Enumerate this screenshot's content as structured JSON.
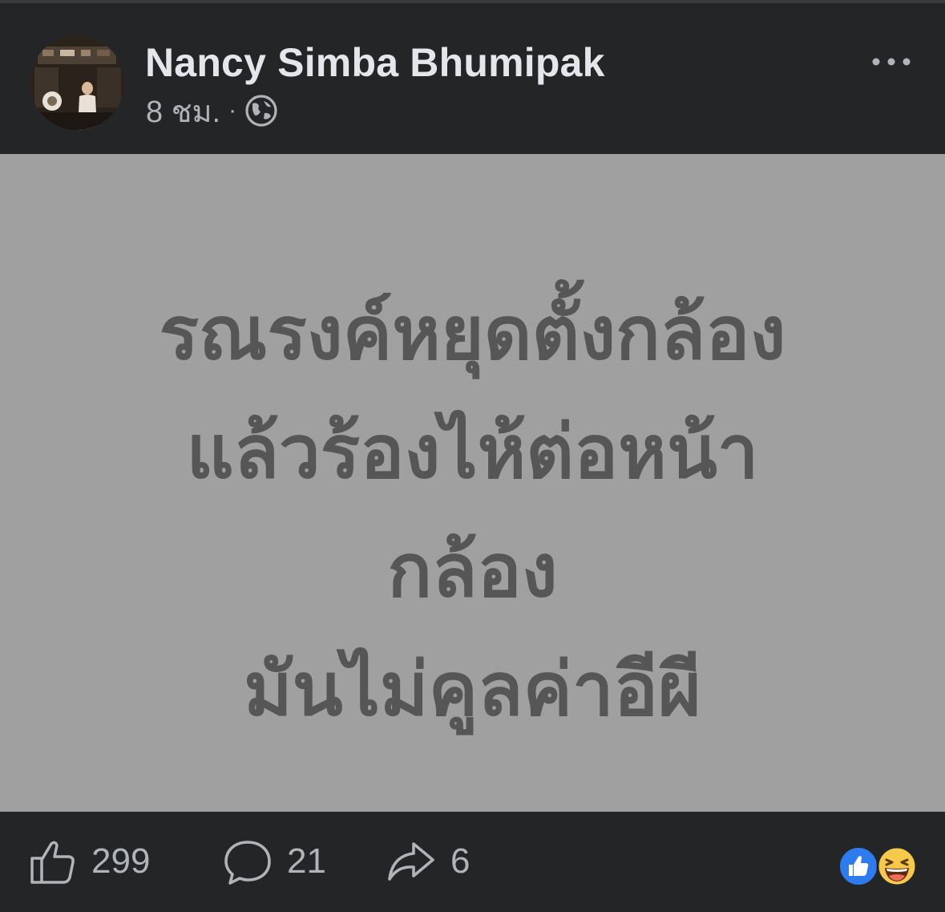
{
  "post": {
    "author": "Nancy Simba Bhumipak",
    "time": "8 ชม.",
    "separator": "·",
    "privacy_icon": "globe-icon",
    "more_icon": "more-options-icon",
    "content_lines": [
      "รณรงค์หยุดตั้งกล้อง",
      "แล้วร้องไห้ต่อหน้า",
      "กล้อง",
      "มันไม่คูลค่าอีผี"
    ],
    "background_color": "#a0a0a0",
    "text_color": "#565656"
  },
  "footer": {
    "likes": "299",
    "comments": "21",
    "shares": "6",
    "like_icon": "thumbs-up-icon",
    "comment_icon": "comment-icon",
    "share_icon": "share-icon",
    "reactions": [
      "like-reaction-icon",
      "haha-reaction-icon"
    ]
  },
  "colors": {
    "surface": "#242526",
    "primary_text": "#e4e6eb",
    "secondary_text": "#b0b3b8",
    "like_blue": "#2e7bf0",
    "haha_yellow": "#f7c94a"
  }
}
